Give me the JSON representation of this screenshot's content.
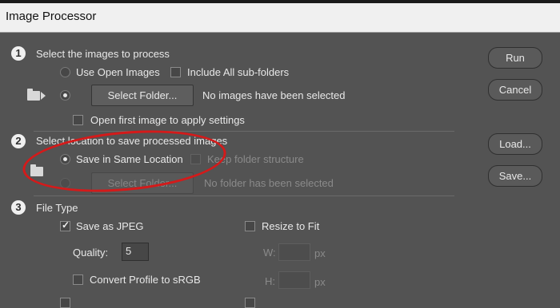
{
  "window": {
    "title": "Image Processor"
  },
  "section1": {
    "number": "1",
    "heading": "Select the images to process",
    "use_open_images": "Use Open Images",
    "include_subfolders": "Include All sub-folders",
    "select_folder": "Select Folder...",
    "folder_status": "No images have been selected",
    "open_first_image": "Open first image to apply settings"
  },
  "section2": {
    "number": "2",
    "heading": "Select location to save processed images",
    "save_same_location": "Save in Same Location",
    "keep_folder_structure": "Keep folder structure",
    "select_folder": "Select Folder...",
    "folder_status": "No folder has been selected"
  },
  "section3": {
    "number": "3",
    "heading": "File Type",
    "save_as_jpeg": "Save as JPEG",
    "resize_to_fit": "Resize to Fit",
    "quality_label": "Quality:",
    "quality_value": "5",
    "width_label": "W:",
    "height_label": "H:",
    "unit": "px",
    "convert_profile": "Convert Profile to sRGB"
  },
  "buttons": {
    "run": "Run",
    "cancel": "Cancel",
    "load": "Load...",
    "save": "Save..."
  },
  "colors": {
    "dialog_bg": "#535353",
    "annotation": "#d41a1a"
  },
  "icons": {
    "open_images": "folder-arrow-icon",
    "save_location": "folder-icon"
  }
}
